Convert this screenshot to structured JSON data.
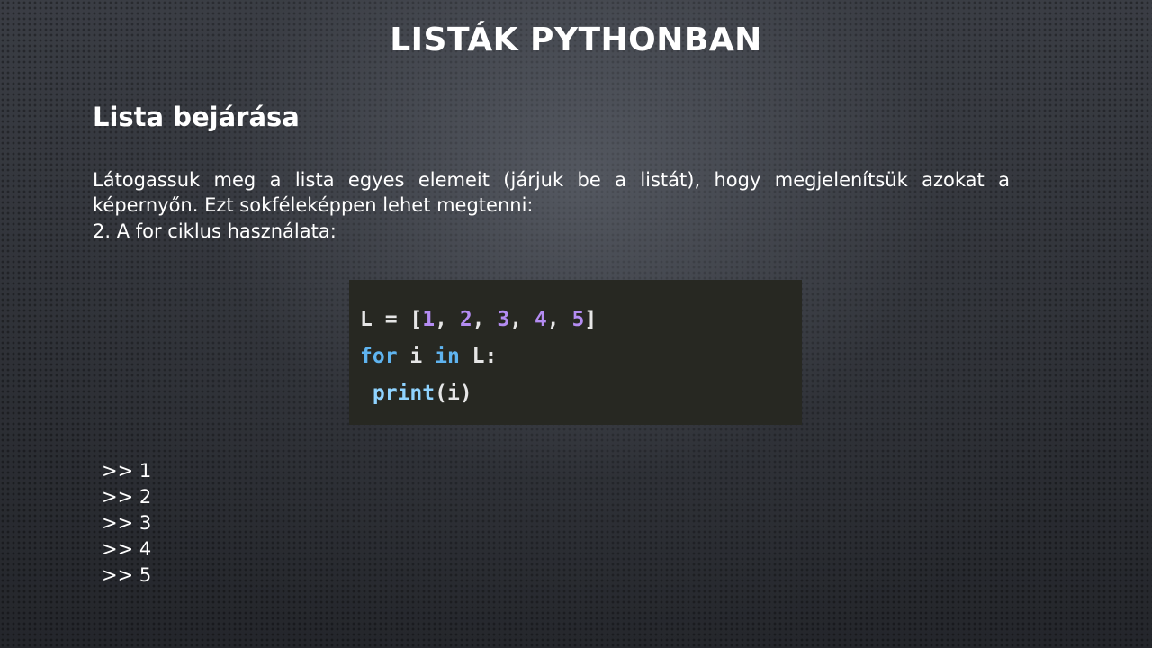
{
  "slide": {
    "title": "LISTÁK PYTHONBAN",
    "subtitle": "Lista bejárása",
    "paragraph": "Látogassuk meg a lista egyes elemeit (járjuk be a listát), hogy megjelenítsük azokat a képernyőn. Ezt sokféleképpen lehet megtenni:",
    "step": "2. A for ciklus használata:"
  },
  "code": {
    "line1": {
      "var": "L = ",
      "open": "[",
      "n1": "1",
      "n2": "2",
      "n3": "3",
      "n4": "4",
      "n5": "5",
      "sep": ", ",
      "close": "]"
    },
    "line2": {
      "kw_for": "for",
      "var_i": " i ",
      "kw_in": "in",
      "rest": " L:"
    },
    "line3": {
      "indent": " ",
      "fn": "print",
      "args": "(i)"
    }
  },
  "output": [
    ">> 1",
    ">> 2",
    ">> 3",
    ">> 4",
    ">> 5"
  ],
  "colors": {
    "keyword": "#5fb4f0",
    "number": "#b48cf2",
    "code_bg": "#272822"
  }
}
